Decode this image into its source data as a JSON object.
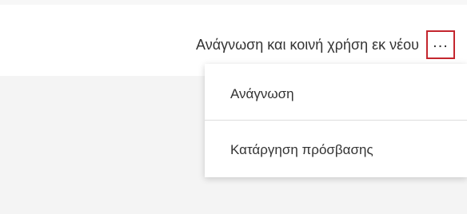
{
  "row": {
    "label": "Ανάγνωση και κοινή χρήση εκ νέου",
    "more_button_label": "..."
  },
  "menu": {
    "items": [
      {
        "label": "Ανάγνωση"
      },
      {
        "label": "Κατάργηση πρόσβασης"
      }
    ]
  },
  "colors": {
    "highlight_border": "#c4262e",
    "background_gray": "#f4f4f4",
    "text": "#333333"
  }
}
